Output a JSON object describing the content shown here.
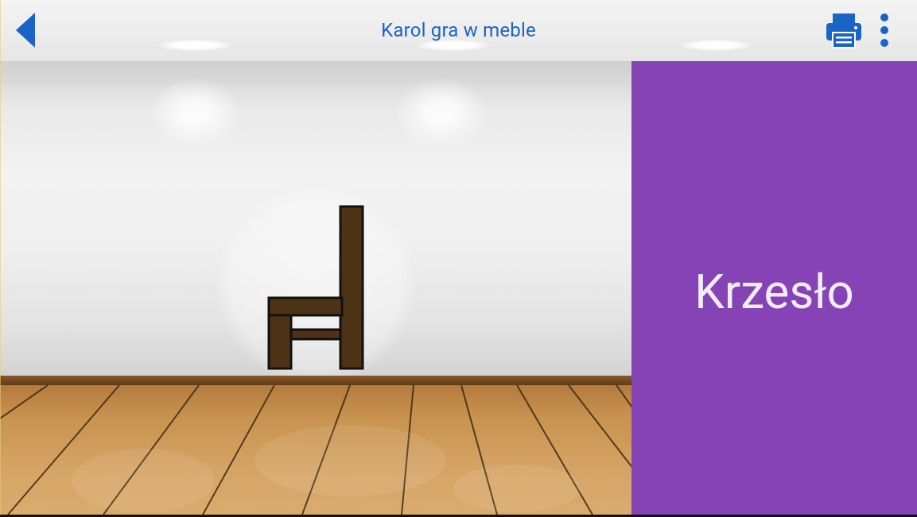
{
  "app": {
    "title": "Karol gra w meble"
  },
  "toolbar": {
    "back_icon": "back-arrow-icon",
    "print_icon": "printer-icon",
    "menu_icon": "more-vert-icon"
  },
  "scene": {
    "object_icon": "chair-icon"
  },
  "panel": {
    "word": "Krzesło",
    "background": "#8543b6"
  },
  "colors": {
    "accent": "#1a63c7",
    "chair": "#4e3216"
  }
}
